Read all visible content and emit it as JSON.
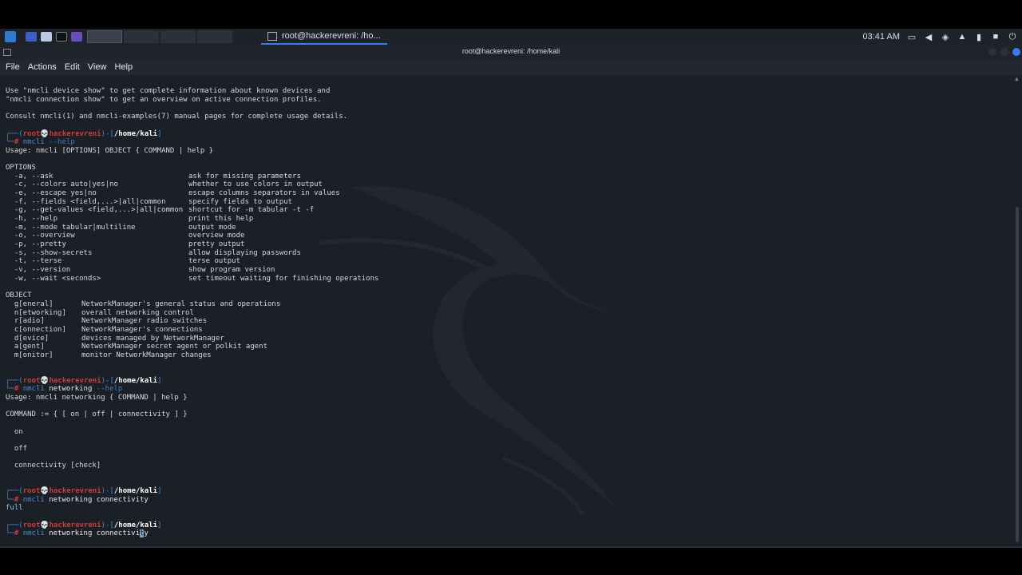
{
  "taskbar": {
    "task_title": "root@hackerevreni: /ho...",
    "clock": "03:41 AM"
  },
  "window": {
    "title": "root@hackerevreni: /home/kali"
  },
  "menu": [
    "File",
    "Actions",
    "Edit",
    "View",
    "Help"
  ],
  "terminal": {
    "intro": [
      "Use \"nmcli device show\" to get complete information about known devices and",
      "\"nmcli connection show\" to get an overview on active connection profiles.",
      "",
      "Consult nmcli(1) and nmcli-examples(7) manual pages for complete usage details."
    ],
    "prompt": {
      "open": "┌──(",
      "user": "root",
      "skull": "💀",
      "host": "hackerevreni",
      "mid": ")-[",
      "path": "/home/kali",
      "close": "]",
      "arrow": "└─",
      "hash": "# "
    },
    "cmd1": {
      "kw": "nmcli",
      "opt": " --help"
    },
    "usage1": "Usage: nmcli [OPTIONS] OBJECT { COMMAND | help }",
    "options_header": "OPTIONS",
    "options": [
      [
        "  -a, --ask",
        "ask for missing parameters"
      ],
      [
        "  -c, --colors auto|yes|no",
        "whether to use colors in output"
      ],
      [
        "  -e, --escape yes|no",
        "escape columns separators in values"
      ],
      [
        "  -f, --fields <field,...>|all|common",
        "specify fields to output"
      ],
      [
        "  -g, --get-values <field,...>|all|common",
        "shortcut for -m tabular -t -f"
      ],
      [
        "  -h, --help",
        "print this help"
      ],
      [
        "  -m, --mode tabular|multiline",
        "output mode"
      ],
      [
        "  -o, --overview",
        "overview mode"
      ],
      [
        "  -p, --pretty",
        "pretty output"
      ],
      [
        "  -s, --show-secrets",
        "allow displaying passwords"
      ],
      [
        "  -t, --terse",
        "terse output"
      ],
      [
        "  -v, --version",
        "show program version"
      ],
      [
        "  -w, --wait <seconds>",
        "set timeout waiting for finishing operations"
      ]
    ],
    "object_header": "OBJECT",
    "objects": [
      [
        "  g[eneral]",
        "NetworkManager's general status and operations"
      ],
      [
        "  n[etworking]",
        "overall networking control"
      ],
      [
        "  r[adio]",
        "NetworkManager radio switches"
      ],
      [
        "  c[onnection]",
        "NetworkManager's connections"
      ],
      [
        "  d[evice]",
        "devices managed by NetworkManager"
      ],
      [
        "  a[gent]",
        "NetworkManager secret agent or polkit agent"
      ],
      [
        "  m[onitor]",
        "monitor NetworkManager changes"
      ]
    ],
    "cmd2": {
      "kw": "nmcli",
      "txt": " networking",
      "opt": " --help"
    },
    "usage2": "Usage: nmcli networking { COMMAND | help }",
    "command_line": "COMMAND := { [ on | off | connectivity ] }",
    "sub_on": "  on",
    "sub_off": "  off",
    "sub_conn": "  connectivity [check]",
    "cmd3": {
      "kw": "nmcli",
      "txt": " networking connectivity"
    },
    "result3": "full",
    "cmd4": {
      "kw": "nmcli",
      "txt": " networking connectivi",
      "cursor": "t",
      "after": "y"
    }
  }
}
